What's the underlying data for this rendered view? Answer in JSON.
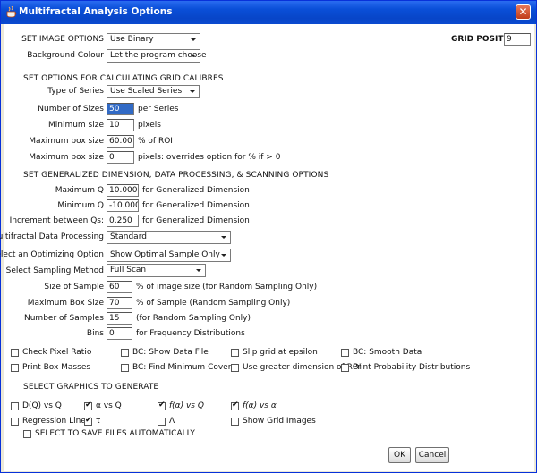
{
  "window": {
    "title": "Multifractal Analysis Options",
    "close_glyph": "✕"
  },
  "image_options": {
    "set_image_label": "SET IMAGE OPTIONS",
    "set_image_value": "Use Binary",
    "background_label": "Background Colour",
    "background_value": "Let the program choose",
    "grid_positions_label": "GRID POSITIONS",
    "grid_positions_value": "9"
  },
  "grid_calibres": {
    "heading": "SET OPTIONS FOR CALCULATING GRID CALIBRES",
    "type_label": "Type of Series",
    "type_value": "Use Scaled Series",
    "num_sizes_label": "Number of Sizes",
    "num_sizes_value": "50",
    "num_sizes_unit": "per Series",
    "min_size_label": "Minimum size",
    "min_size_value": "10",
    "min_size_unit": "pixels",
    "max_box_pct_label": "Maximum box size",
    "max_box_pct_value": "60.00",
    "max_box_pct_unit": "% of ROI",
    "max_box_px_label": "Maximum box size",
    "max_box_px_value": "0",
    "max_box_px_unit": "pixels: overrides option for % if > 0"
  },
  "generalized": {
    "heading": "SET GENERALIZED DIMENSION, DATA PROCESSING, & SCANNING OPTIONS",
    "max_q_label": "Maximum Q",
    "max_q_value": "10.000",
    "max_q_unit": "for Generalized Dimension",
    "min_q_label": "Minimum Q",
    "min_q_value": "-10.000",
    "min_q_unit": "for Generalized Dimension",
    "inc_label": "Increment between Qs:",
    "inc_value": "0.250",
    "inc_unit": "for Generalized Dimension",
    "processing_label": "Multifractal Data Processing",
    "processing_value": "Standard",
    "optimizing_label": "Select an Optimizing Option",
    "optimizing_value": "Show Optimal Sample Only",
    "sampling_label": "Select Sampling Method",
    "sampling_value": "Full Scan",
    "sample_size_label": "Size of Sample",
    "sample_size_value": "60",
    "sample_size_unit": "% of image size (for Random Sampling Only)",
    "max_box_sample_label": "Maximum Box Size",
    "max_box_sample_value": "70",
    "max_box_sample_unit": "% of Sample (Random Sampling Only)",
    "num_samples_label": "Number of Samples",
    "num_samples_value": "15",
    "num_samples_unit": "(for Random Sampling Only)",
    "bins_label": "Bins",
    "bins_value": "0",
    "bins_unit": "for Frequency Distributions"
  },
  "checkboxes": {
    "check_pixel_ratio": "Check Pixel Ratio",
    "bc_show_data_file": "BC: Show Data File",
    "slip_grid": "Slip grid at epsilon",
    "bc_smooth_data": "BC: Smooth Data",
    "print_box_masses": "Print Box Masses",
    "bc_find_min_cover": "BC: Find Minimum Cover",
    "use_greater_dim": "Use greater dimension of ROI",
    "print_prob_dist": "Print Probability Distributions"
  },
  "graphics": {
    "heading": "SELECT GRAPHICS TO GENERATE",
    "dq_vs_q": "D(Q) vs Q",
    "alpha_vs_q": "α vs Q",
    "f_alpha_vs_q": "f(α) vs Q",
    "f_alpha_vs_alpha": "f(α) vs α",
    "regression_lines": "Regression Lines",
    "tau": "τ",
    "lambda": "Λ",
    "show_grid_images": "Show Grid Images",
    "save_files": "SELECT TO SAVE FILES AUTOMATICALLY",
    "checked": {
      "dq_vs_q": false,
      "alpha_vs_q": true,
      "f_alpha_vs_q": true,
      "f_alpha_vs_alpha": true,
      "regression_lines": false,
      "tau": true,
      "lambda": false,
      "show_grid_images": false,
      "save_files": false
    }
  },
  "buttons": {
    "ok": "OK",
    "cancel": "Cancel"
  }
}
